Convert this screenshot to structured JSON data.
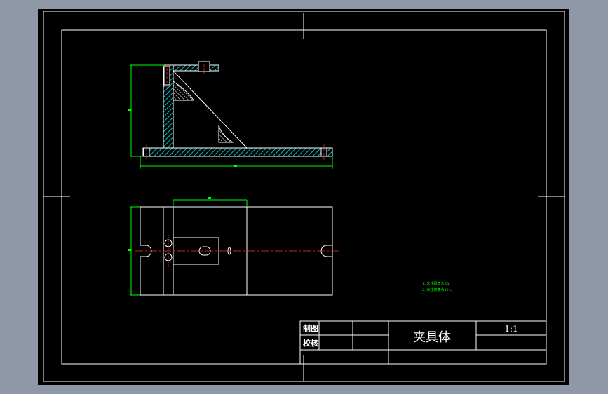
{
  "title_block": {
    "drawn_label": "制图",
    "checked_label": "校核",
    "part_name": "夹具体",
    "scale": "1:1"
  },
  "notes": {
    "line1": "1. 未注圆角为R5。",
    "line2": "2. 未注倒角为45°。"
  },
  "colors": {
    "background": "#000000",
    "frame": "#ffffff",
    "section_fill": "#00c0c0",
    "dimension": "#00ff00",
    "centerline": "#ff0000",
    "notes": "#00ff00"
  }
}
